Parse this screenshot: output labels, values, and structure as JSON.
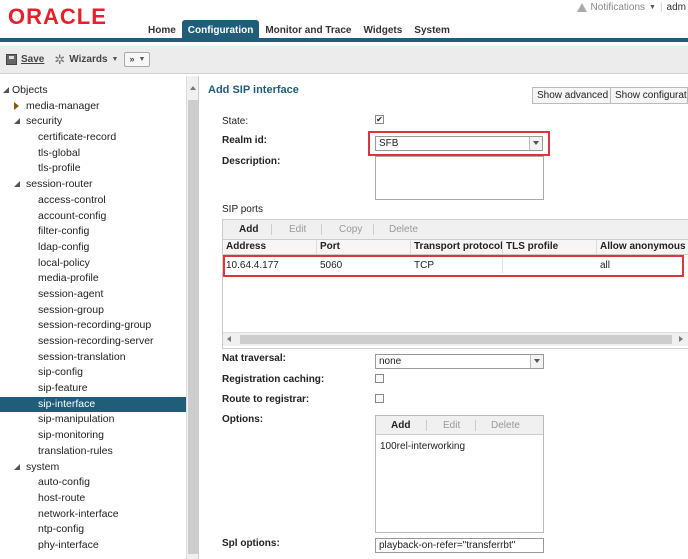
{
  "header": {
    "logo": "ORACLE",
    "notifications_label": "Notifications",
    "user_label": "adm"
  },
  "nav": {
    "tabs": [
      {
        "label": "Home",
        "active": false
      },
      {
        "label": "Configuration",
        "active": true
      },
      {
        "label": "Monitor and Trace",
        "active": false
      },
      {
        "label": "Widgets",
        "active": false
      },
      {
        "label": "System",
        "active": false
      }
    ]
  },
  "toolbar": {
    "save_label": "Save",
    "wizards_label": "Wizards",
    "more_label": "»"
  },
  "sidebar": {
    "items": [
      {
        "label": "Objects",
        "level": 0,
        "toggle": "open"
      },
      {
        "label": "media-manager",
        "level": 1,
        "toggle": "closed"
      },
      {
        "label": "security",
        "level": 1,
        "toggle": "open"
      },
      {
        "label": "certificate-record",
        "level": 2
      },
      {
        "label": "tls-global",
        "level": 2
      },
      {
        "label": "tls-profile",
        "level": 2
      },
      {
        "label": "session-router",
        "level": 1,
        "toggle": "open"
      },
      {
        "label": "access-control",
        "level": 2
      },
      {
        "label": "account-config",
        "level": 2
      },
      {
        "label": "filter-config",
        "level": 2
      },
      {
        "label": "ldap-config",
        "level": 2
      },
      {
        "label": "local-policy",
        "level": 2
      },
      {
        "label": "media-profile",
        "level": 2
      },
      {
        "label": "session-agent",
        "level": 2
      },
      {
        "label": "session-group",
        "level": 2
      },
      {
        "label": "session-recording-group",
        "level": 2
      },
      {
        "label": "session-recording-server",
        "level": 2
      },
      {
        "label": "session-translation",
        "level": 2
      },
      {
        "label": "sip-config",
        "level": 2
      },
      {
        "label": "sip-feature",
        "level": 2
      },
      {
        "label": "sip-interface",
        "level": 2,
        "selected": true
      },
      {
        "label": "sip-manipulation",
        "level": 2
      },
      {
        "label": "sip-monitoring",
        "level": 2
      },
      {
        "label": "translation-rules",
        "level": 2
      },
      {
        "label": "system",
        "level": 1,
        "toggle": "open"
      },
      {
        "label": "auto-config",
        "level": 2
      },
      {
        "label": "host-route",
        "level": 2
      },
      {
        "label": "network-interface",
        "level": 2
      },
      {
        "label": "ntp-config",
        "level": 2
      },
      {
        "label": "phy-interface",
        "level": 2
      }
    ]
  },
  "main": {
    "title": "Add SIP interface",
    "show_advanced_label": "Show advanced",
    "show_config_label": "Show configurat",
    "state_label": "State:",
    "state_checked": "✔",
    "realm_label": "Realm id:",
    "realm_value": "SFB",
    "description_label": "Description:",
    "sip_ports_label": "SIP ports",
    "grid_buttons": [
      "Add",
      "Edit",
      "Copy",
      "Delete"
    ],
    "columns": [
      "Address",
      "Port",
      "Transport protocol",
      "TLS profile",
      "Allow anonymous"
    ],
    "rows": [
      {
        "address": "10.64.4.177",
        "port": "5060",
        "transport": "TCP",
        "tls": "",
        "anonymous": "all"
      }
    ],
    "nat_label": "Nat traversal:",
    "nat_value": "none",
    "reg_caching_label": "Registration caching:",
    "route_label": "Route to registrar:",
    "options_label": "Options:",
    "options_buttons": [
      "Add",
      "Edit",
      "Delete"
    ],
    "options_items": [
      "100rel-interworking"
    ],
    "spl_label": "Spl options:",
    "spl_value": "playback-on-refer=\"transferrbt\""
  },
  "colors": {
    "brand_red": "#e8202b",
    "nav_blue": "#1f5d79",
    "highlight_red": "#d9363e"
  }
}
